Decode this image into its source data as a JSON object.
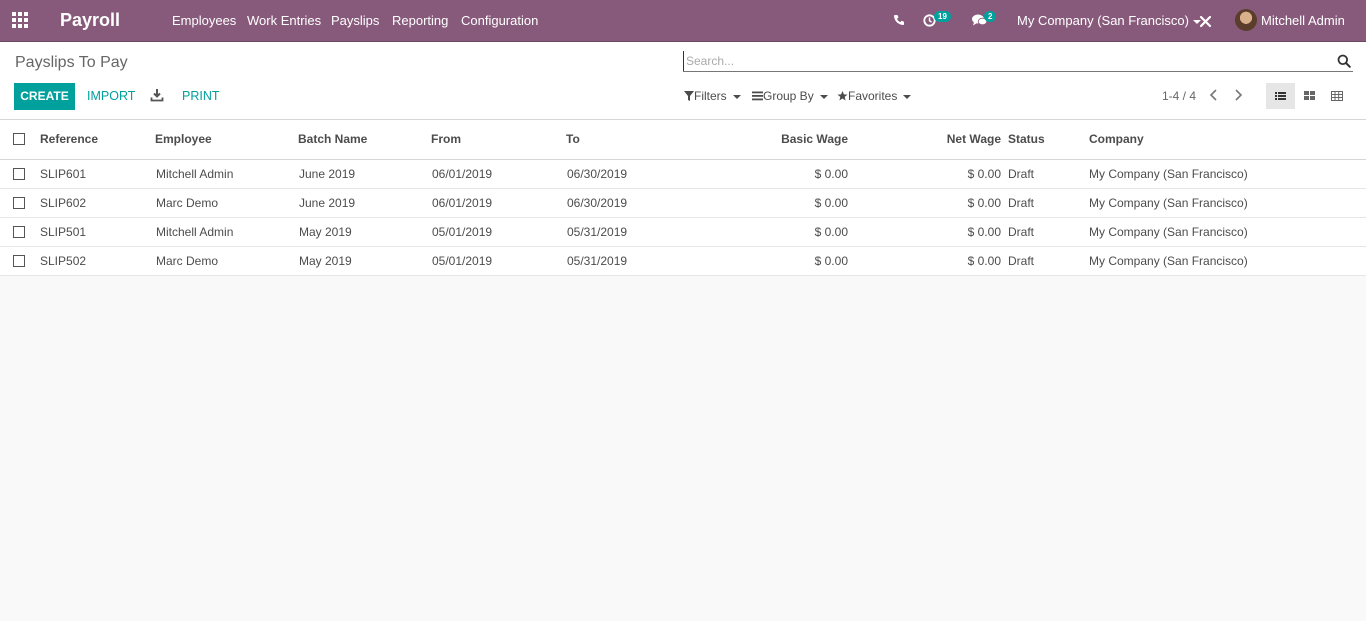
{
  "navbar": {
    "brand": "Payroll",
    "menu": [
      "Employees",
      "Work Entries",
      "Payslips",
      "Reporting",
      "Configuration"
    ],
    "activities_count": "19",
    "messages_count": "2",
    "company": "My Company (San Francisco)",
    "user": "Mitchell Admin",
    "accent": "#875a7b"
  },
  "control": {
    "breadcrumb": "Payslips To Pay",
    "search_placeholder": "Search...",
    "create_label": "CREATE",
    "import_label": "IMPORT",
    "print_label": "PRINT",
    "filters_label": "Filters",
    "groupby_label": "Group By",
    "favorites_label": "Favorites",
    "pager": "1-4 / 4",
    "primary_color": "#00a09d"
  },
  "table": {
    "headers": {
      "reference": "Reference",
      "employee": "Employee",
      "batch": "Batch Name",
      "from": "From",
      "to": "To",
      "basic": "Basic Wage",
      "net": "Net Wage",
      "status": "Status",
      "company": "Company"
    },
    "rows": [
      {
        "reference": "SLIP601",
        "employee": "Mitchell Admin",
        "batch": "June 2019",
        "from": "06/01/2019",
        "to": "06/30/2019",
        "basic": "$ 0.00",
        "net": "$ 0.00",
        "status": "Draft",
        "company": "My Company (San Francisco)"
      },
      {
        "reference": "SLIP602",
        "employee": "Marc Demo",
        "batch": "June 2019",
        "from": "06/01/2019",
        "to": "06/30/2019",
        "basic": "$ 0.00",
        "net": "$ 0.00",
        "status": "Draft",
        "company": "My Company (San Francisco)"
      },
      {
        "reference": "SLIP501",
        "employee": "Mitchell Admin",
        "batch": "May 2019",
        "from": "05/01/2019",
        "to": "05/31/2019",
        "basic": "$ 0.00",
        "net": "$ 0.00",
        "status": "Draft",
        "company": "My Company (San Francisco)"
      },
      {
        "reference": "SLIP502",
        "employee": "Marc Demo",
        "batch": "May 2019",
        "from": "05/01/2019",
        "to": "05/31/2019",
        "basic": "$ 0.00",
        "net": "$ 0.00",
        "status": "Draft",
        "company": "My Company (San Francisco)"
      }
    ]
  }
}
